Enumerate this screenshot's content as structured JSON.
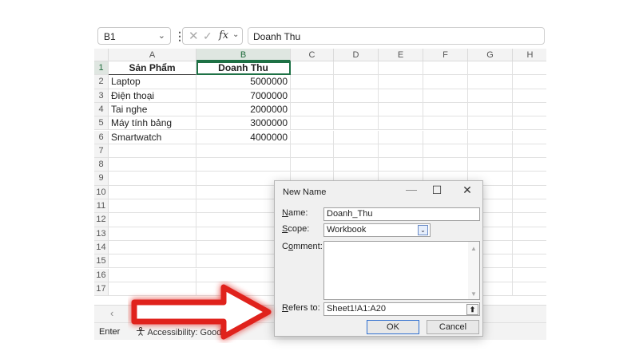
{
  "formula_bar": {
    "name_box": "B1",
    "dropdown_glyph": "⌄",
    "separator": "⋮",
    "cancel_glyph": "✕",
    "enter_glyph": "✓",
    "fx": "fx",
    "formula_dropdown_glyph": "⌄",
    "value": "Doanh Thu"
  },
  "columns": [
    "A",
    "B",
    "C",
    "D",
    "E",
    "F",
    "G",
    "H"
  ],
  "rows": [
    {
      "n": "1",
      "a": "Sản Phẩm",
      "b": "Doanh Thu"
    },
    {
      "n": "2",
      "a": "Laptop",
      "b": "5000000"
    },
    {
      "n": "3",
      "a": "Điện thoại",
      "b": "7000000"
    },
    {
      "n": "4",
      "a": "Tai nghe",
      "b": "2000000"
    },
    {
      "n": "5",
      "a": "Máy tính bảng",
      "b": "3000000"
    },
    {
      "n": "6",
      "a": "Smartwatch",
      "b": "4000000"
    },
    {
      "n": "7",
      "a": "",
      "b": ""
    },
    {
      "n": "8",
      "a": "",
      "b": ""
    },
    {
      "n": "9",
      "a": "",
      "b": ""
    },
    {
      "n": "10",
      "a": "",
      "b": ""
    },
    {
      "n": "11",
      "a": "",
      "b": ""
    },
    {
      "n": "12",
      "a": "",
      "b": ""
    },
    {
      "n": "13",
      "a": "",
      "b": ""
    },
    {
      "n": "14",
      "a": "",
      "b": ""
    },
    {
      "n": "15",
      "a": "",
      "b": ""
    },
    {
      "n": "16",
      "a": "",
      "b": ""
    },
    {
      "n": "17",
      "a": "",
      "b": ""
    }
  ],
  "sheet_bar": {
    "scroll_left": "‹"
  },
  "status": {
    "mode": "Enter",
    "accessibility": "Accessibility: Good to"
  },
  "dialog": {
    "title": "New Name",
    "minimize": "—",
    "maximize": "☐",
    "close": "✕",
    "name_label_key": "N",
    "name_label_rest": "ame:",
    "name_value": "Doanh_Thu",
    "scope_label_key": "S",
    "scope_label_rest": "cope:",
    "scope_value": "Workbook",
    "scope_dropdown": "⌄",
    "comment_label_pre": "C",
    "comment_label_key": "o",
    "comment_label_rest": "mment:",
    "comment_scroll_up": "▲",
    "comment_scroll_down": "▼",
    "refers_label_key": "R",
    "refers_label_rest": "efers to:",
    "refers_value": "Sheet1!A1:A20",
    "collapse_glyph": "⬆",
    "ok": "OK",
    "cancel": "Cancel"
  },
  "colors": {
    "excel_green": "#1e7145",
    "arrow_red": "#e0201a"
  }
}
